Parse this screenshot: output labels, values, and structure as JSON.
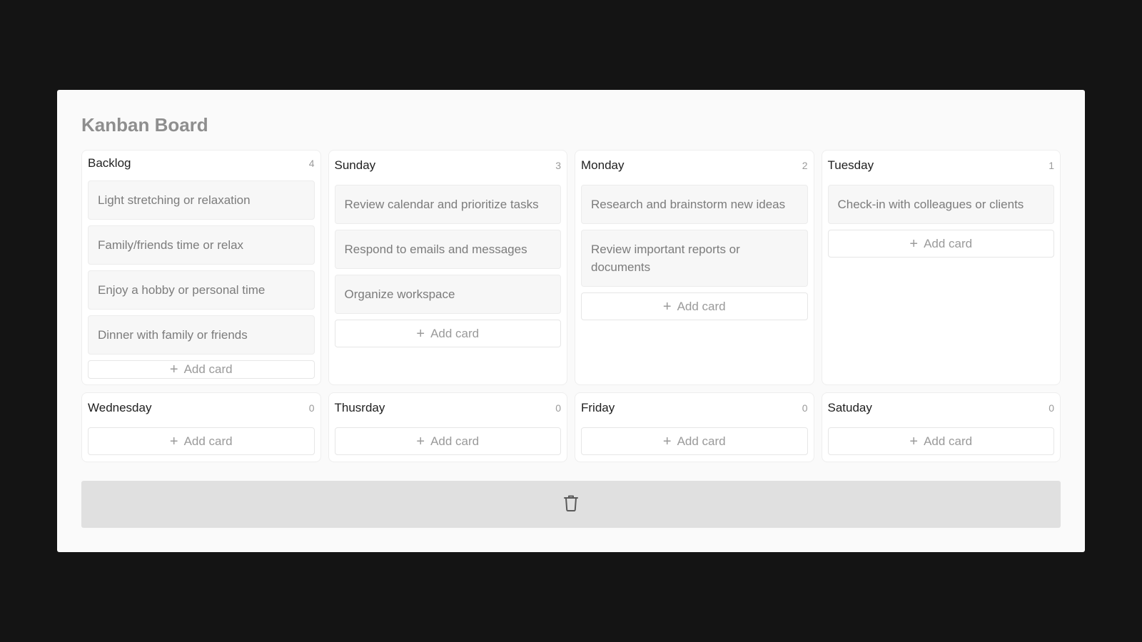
{
  "board": {
    "title": "Kanban Board"
  },
  "columns": [
    {
      "title": "Backlog",
      "count": "4",
      "cards": [
        "Light stretching or relaxation",
        "Family/friends time or relax",
        "Enjoy a hobby or personal time",
        "Dinner with family or friends"
      ],
      "add_label": "Add card"
    },
    {
      "title": "Sunday",
      "count": "3",
      "cards": [
        "Review calendar and prioritize tasks",
        "Respond to emails and messages",
        "Organize workspace"
      ],
      "add_label": "Add card"
    },
    {
      "title": "Monday",
      "count": "2",
      "cards": [
        "Research and brainstorm new ideas",
        "Review important reports or documents"
      ],
      "add_label": "Add card"
    },
    {
      "title": "Tuesday",
      "count": "1",
      "cards": [
        "Check-in with colleagues or clients"
      ],
      "add_label": "Add card"
    },
    {
      "title": "Wednesday",
      "count": "0",
      "cards": [],
      "add_label": "Add card"
    },
    {
      "title": "Thusrday",
      "count": "0",
      "cards": [],
      "add_label": "Add card"
    },
    {
      "title": "Friday",
      "count": "0",
      "cards": [],
      "add_label": "Add card"
    },
    {
      "title": "Satuday",
      "count": "0",
      "cards": [],
      "add_label": "Add card"
    }
  ],
  "icons": {
    "add": "plus-icon",
    "trash": "trash-icon"
  },
  "colors": {
    "background": "#141414",
    "board": "#fafafa",
    "trash_zone": "#e0e0e0"
  }
}
